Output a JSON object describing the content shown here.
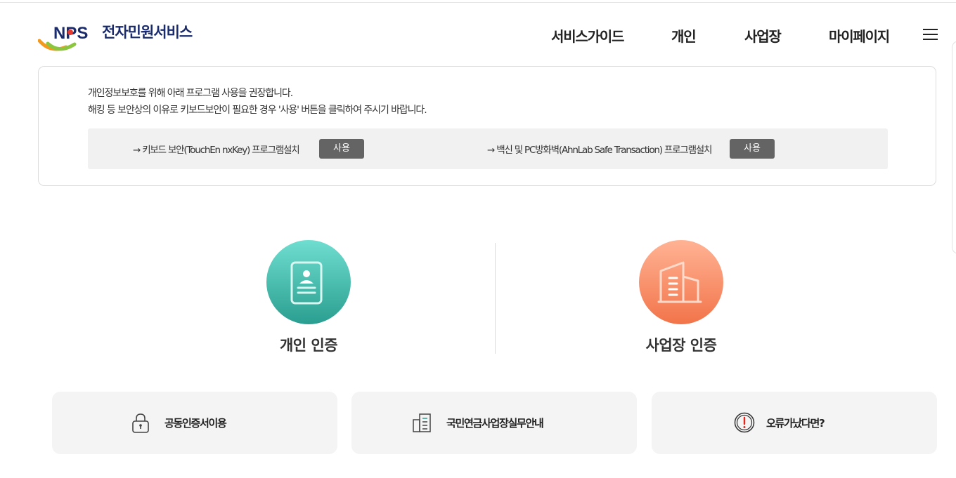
{
  "header": {
    "logo_text": "전자민원서비스",
    "nav": [
      {
        "label": "서비스가이드"
      },
      {
        "label": "개인"
      },
      {
        "label": "사업장"
      },
      {
        "label": "마이페이지"
      }
    ]
  },
  "notice": {
    "line1": "개인정보보호를 위해 아래 프로그램 사용을 권장합니다.",
    "line2": "해킹 등 보안상의 이유로 키보드보안이 필요한 경우 '사용' 버튼을 클릭하여 주시기 바랍니다.",
    "programs": [
      {
        "label": "→ 키보드 보안(TouchEn nxKey) 프로그램설치",
        "button": "사용"
      },
      {
        "label": "→ 백신 및 PC방화벽(AhnLab Safe Transaction) 프로그램설치",
        "button": "사용"
      }
    ]
  },
  "auth": {
    "personal": {
      "title": "개인 인증"
    },
    "business": {
      "title": "사업장 인증"
    }
  },
  "cards": [
    {
      "label": "공동인증서이용",
      "icon": "lock-icon"
    },
    {
      "label": "국민연금사업장실무안내",
      "icon": "document-building-icon"
    },
    {
      "label": "오류가났다면?",
      "icon": "alert-circle-icon"
    }
  ],
  "colors": {
    "personal_gradient": [
      "#6fded0",
      "#2a9e90"
    ],
    "business_gradient": [
      "#ffb394",
      "#f2744a"
    ],
    "brand_navy": "#1a2b6d"
  }
}
